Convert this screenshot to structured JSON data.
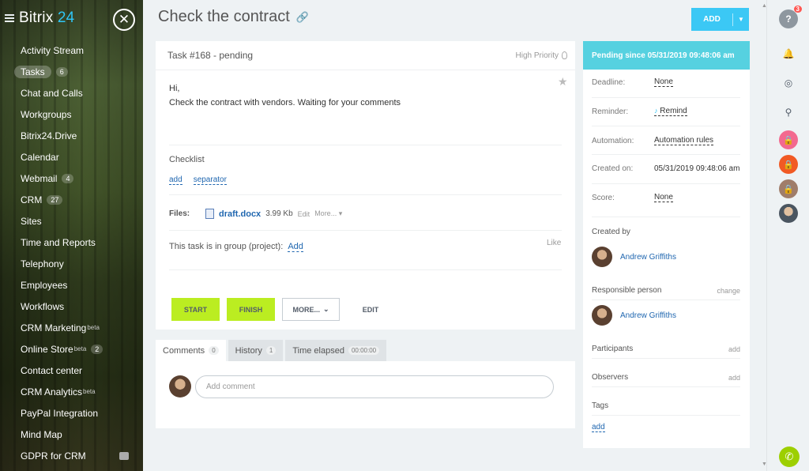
{
  "sidebar": {
    "brand_prefix": "Bitrix",
    "brand_num": "24",
    "items": [
      {
        "label": "Activity Stream"
      },
      {
        "label": "Tasks",
        "count": "6",
        "active": true
      },
      {
        "label": "Chat and Calls"
      },
      {
        "label": "Workgroups"
      },
      {
        "label": "Bitrix24.Drive"
      },
      {
        "label": "Calendar"
      },
      {
        "label": "Webmail",
        "count": "4"
      },
      {
        "label": "CRM",
        "count": "27"
      },
      {
        "label": "Sites"
      },
      {
        "label": "Time and Reports"
      },
      {
        "label": "Telephony"
      },
      {
        "label": "Employees"
      },
      {
        "label": "Workflows"
      },
      {
        "label": "CRM Marketing",
        "sup": "beta"
      },
      {
        "label": "Online Store",
        "sup": "beta",
        "count": "2"
      },
      {
        "label": "Contact center"
      },
      {
        "label": "CRM Analytics",
        "sup": "beta"
      },
      {
        "label": "PayPal Integration"
      },
      {
        "label": "Mind Map"
      },
      {
        "label": "GDPR for CRM"
      }
    ]
  },
  "header": {
    "title": "Check the contract",
    "add_label": "ADD"
  },
  "task": {
    "number": "Task #168 - pending",
    "priority": "High Priority",
    "greeting": "Hi,",
    "description": "Check the contract with vendors. Waiting for your comments",
    "checklist_title": "Checklist",
    "checklist_add": "add",
    "checklist_separator": "separator",
    "files_label": "Files:",
    "file_name": "draft.docx",
    "file_size": "3.99 Kb",
    "file_edit": "Edit",
    "file_more": "More...",
    "group_text": "This task is in group (project):",
    "group_add": "Add",
    "like": "Like",
    "btn_start": "START",
    "btn_finish": "FINISH",
    "btn_more": "MORE...",
    "btn_edit": "EDIT"
  },
  "tabs": [
    {
      "label": "Comments",
      "count": "0"
    },
    {
      "label": "History",
      "count": "1"
    },
    {
      "label": "Time elapsed",
      "count": "00:00:00"
    }
  ],
  "comments": {
    "placeholder": "Add comment"
  },
  "details": {
    "status": "Pending since 05/31/2019 09:48:06 am",
    "deadline_label": "Deadline:",
    "deadline_value": "None",
    "reminder_label": "Reminder:",
    "reminder_value": "Remind",
    "automation_label": "Automation:",
    "automation_value": "Automation rules",
    "created_on_label": "Created on:",
    "created_on_value": "05/31/2019 09:48:06 am",
    "score_label": "Score:",
    "score_value": "None",
    "created_by_label": "Created by",
    "created_by_name": "Andrew Griffiths",
    "responsible_label": "Responsible person",
    "responsible_change": "change",
    "responsible_name": "Andrew Griffiths",
    "participants_label": "Participants",
    "participants_add": "add",
    "observers_label": "Observers",
    "observers_add": "add",
    "tags_label": "Tags",
    "tags_add": "add"
  },
  "rail": {
    "help_badge": "3",
    "lock_colors": [
      "#f3698f",
      "#f15a24",
      "#a07d6a"
    ]
  }
}
